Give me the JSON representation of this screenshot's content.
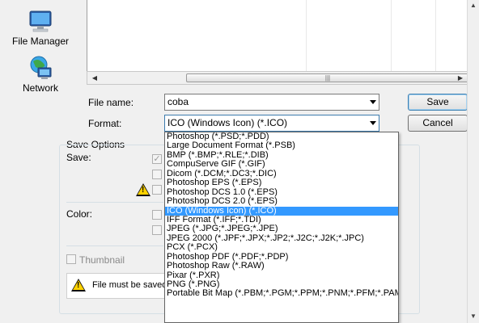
{
  "places": [
    {
      "label": "File Manager",
      "icon": "file-manager-icon"
    },
    {
      "label": "Network",
      "icon": "network-icon"
    }
  ],
  "file_name": {
    "label": "File name:",
    "value": "coba"
  },
  "format": {
    "label": "Format:",
    "value": "ICO (Windows Icon) (*.ICO)"
  },
  "buttons": {
    "save": "Save",
    "cancel": "Cancel"
  },
  "save_options": {
    "title": "Save Options",
    "save_label": "Save:",
    "color_label": "Color:",
    "thumbnail_label": "Thumbnail",
    "message": "File must be saved a"
  },
  "format_options": [
    "Photoshop (*.PSD;*.PDD)",
    "Large Document Format (*.PSB)",
    "BMP (*.BMP;*.RLE;*.DIB)",
    "CompuServe GIF (*.GIF)",
    "Dicom (*.DCM;*.DC3;*.DIC)",
    "Photoshop EPS (*.EPS)",
    "Photoshop DCS 1.0 (*.EPS)",
    "Photoshop DCS 2.0 (*.EPS)",
    "ICO (Windows Icon) (*.ICO)",
    "IFF Format (*.IFF;*.TDI)",
    "JPEG (*.JPG;*.JPEG;*.JPE)",
    "JPEG 2000 (*.JPF;*.JPX;*.JP2;*.J2C;*.J2K;*.JPC)",
    "PCX (*.PCX)",
    "Photoshop PDF (*.PDF;*.PDP)",
    "Photoshop Raw (*.RAW)",
    "Pixar (*.PXR)",
    "PNG (*.PNG)",
    "Portable Bit Map (*.PBM;*.PGM;*.PPM;*.PNM;*.PFM;*.PAM)"
  ],
  "selected_format_index": 8,
  "colors": {
    "selection": "#3399ff",
    "accent_border": "#3c7fb1",
    "warning": "#ffd200"
  }
}
